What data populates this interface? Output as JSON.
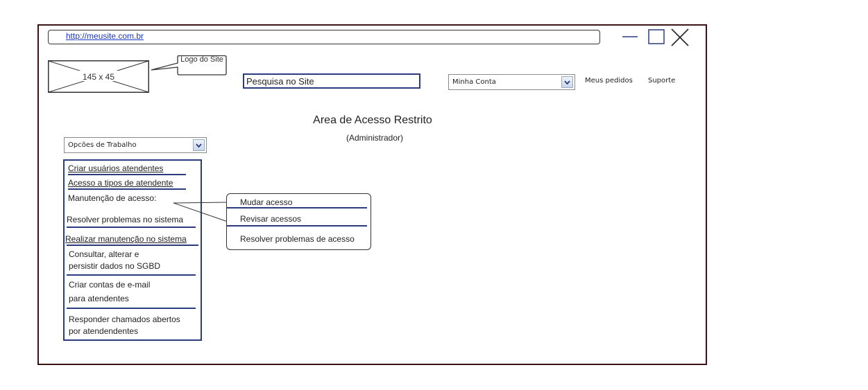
{
  "address_bar": {
    "url": "http://meusite.com.br"
  },
  "window_controls": {
    "minimize": "minimize-icon",
    "maximize": "maximize-icon",
    "close": "close-icon"
  },
  "logo": {
    "placeholder_text": "145 x 45",
    "callout": "Logo do Site"
  },
  "search": {
    "value": "Pesquisa no Site"
  },
  "account": {
    "selected": "Minha Conta"
  },
  "nav": {
    "orders": "Meus pedidos",
    "support": "Suporte"
  },
  "page": {
    "title": "Area de Acesso Restrito",
    "subtitle": "(Administrador)"
  },
  "work_options": {
    "selected": "Opcões de Trabalho"
  },
  "menu": {
    "items": [
      "Criar usuários atendentes",
      "Acesso a tipos de atendente",
      "Manutenção de acesso:",
      "Resolver problemas no sistema",
      "Realizar manutenção no sistema",
      "Consultar, alterar e",
      "persistir dados no SGBD",
      "Criar contas de e-mail",
      "para atendentes",
      "Responder chamados abertos",
      "por atendendentes"
    ]
  },
  "submenu": {
    "items": [
      "Mudar acesso",
      "Revisar acessos",
      "Resolver problemas de acesso"
    ]
  },
  "colors": {
    "frame": "#3a1414",
    "accent": "#2b3a7e",
    "link": "#1a35c9"
  }
}
